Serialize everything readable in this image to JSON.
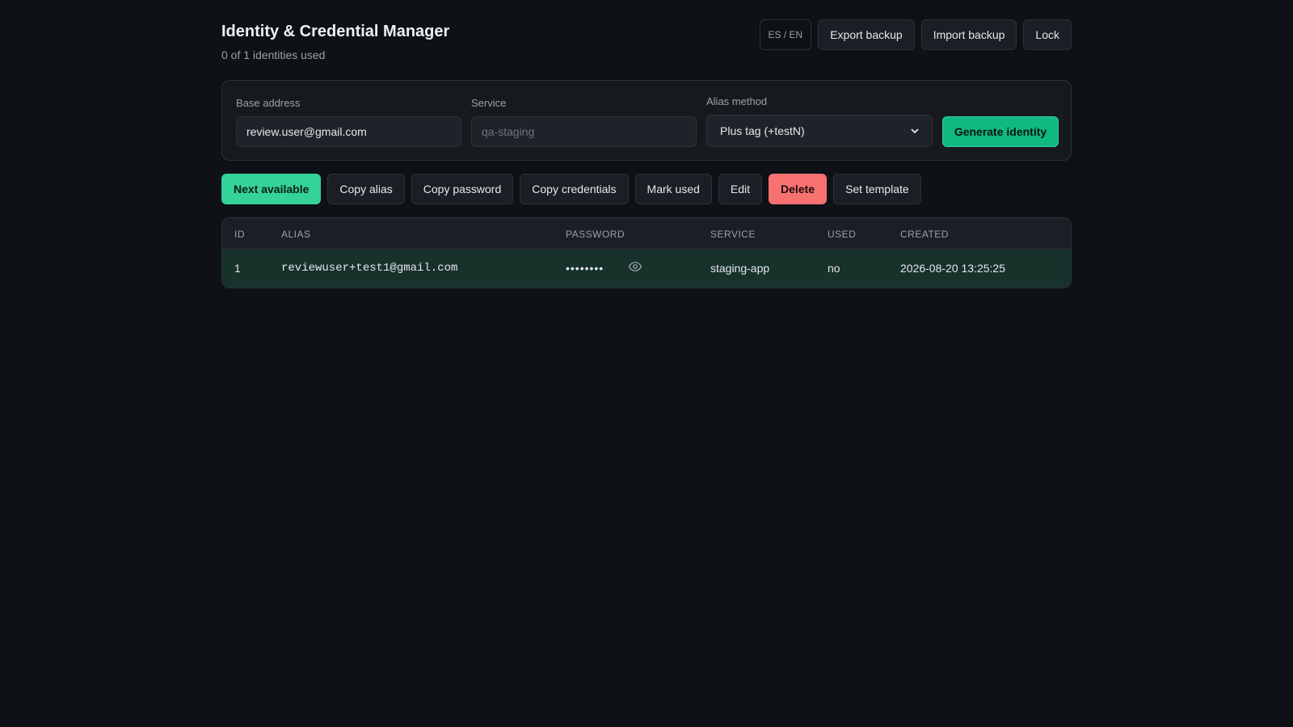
{
  "app": {
    "title": "Identity & Credential Manager",
    "usage": "0 of 1 identities used"
  },
  "header_actions": {
    "lang": "ES / EN",
    "export": "Export backup",
    "import": "Import backup",
    "lock": "Lock"
  },
  "form": {
    "base_address_label": "Base address",
    "base_address_value": "review.user@gmail.com",
    "service_label": "Service",
    "service_placeholder": "qa-staging",
    "service_value": "",
    "alias_method_label": "Alias method",
    "alias_method_selected": "Plus tag (+testN)",
    "generate_label": "Generate identity"
  },
  "toolbar": {
    "next": "Next available",
    "copy_alias": "Copy alias",
    "copy_password": "Copy password",
    "copy_credentials": "Copy credentials",
    "mark_used": "Mark used",
    "edit": "Edit",
    "delete": "Delete",
    "set_template": "Set template"
  },
  "table": {
    "columns": [
      "ID",
      "ALIAS",
      "PASSWORD",
      "SERVICE",
      "USED",
      "CREATED"
    ],
    "rows": [
      {
        "id": "1",
        "alias": "reviewuser+test1@gmail.com",
        "password_masked": "••••••••",
        "service": "staging-app",
        "used": "no",
        "created": "2026-08-20 13:25:25"
      }
    ]
  },
  "colors": {
    "background": "#0e1115",
    "accent_green": "#34d399",
    "generate_green": "#10b981",
    "danger_red": "#f87171",
    "selected_row": "#17312b"
  },
  "icons": {
    "reveal_password": "eye-icon",
    "select_arrow": "chevron-down-icon"
  }
}
